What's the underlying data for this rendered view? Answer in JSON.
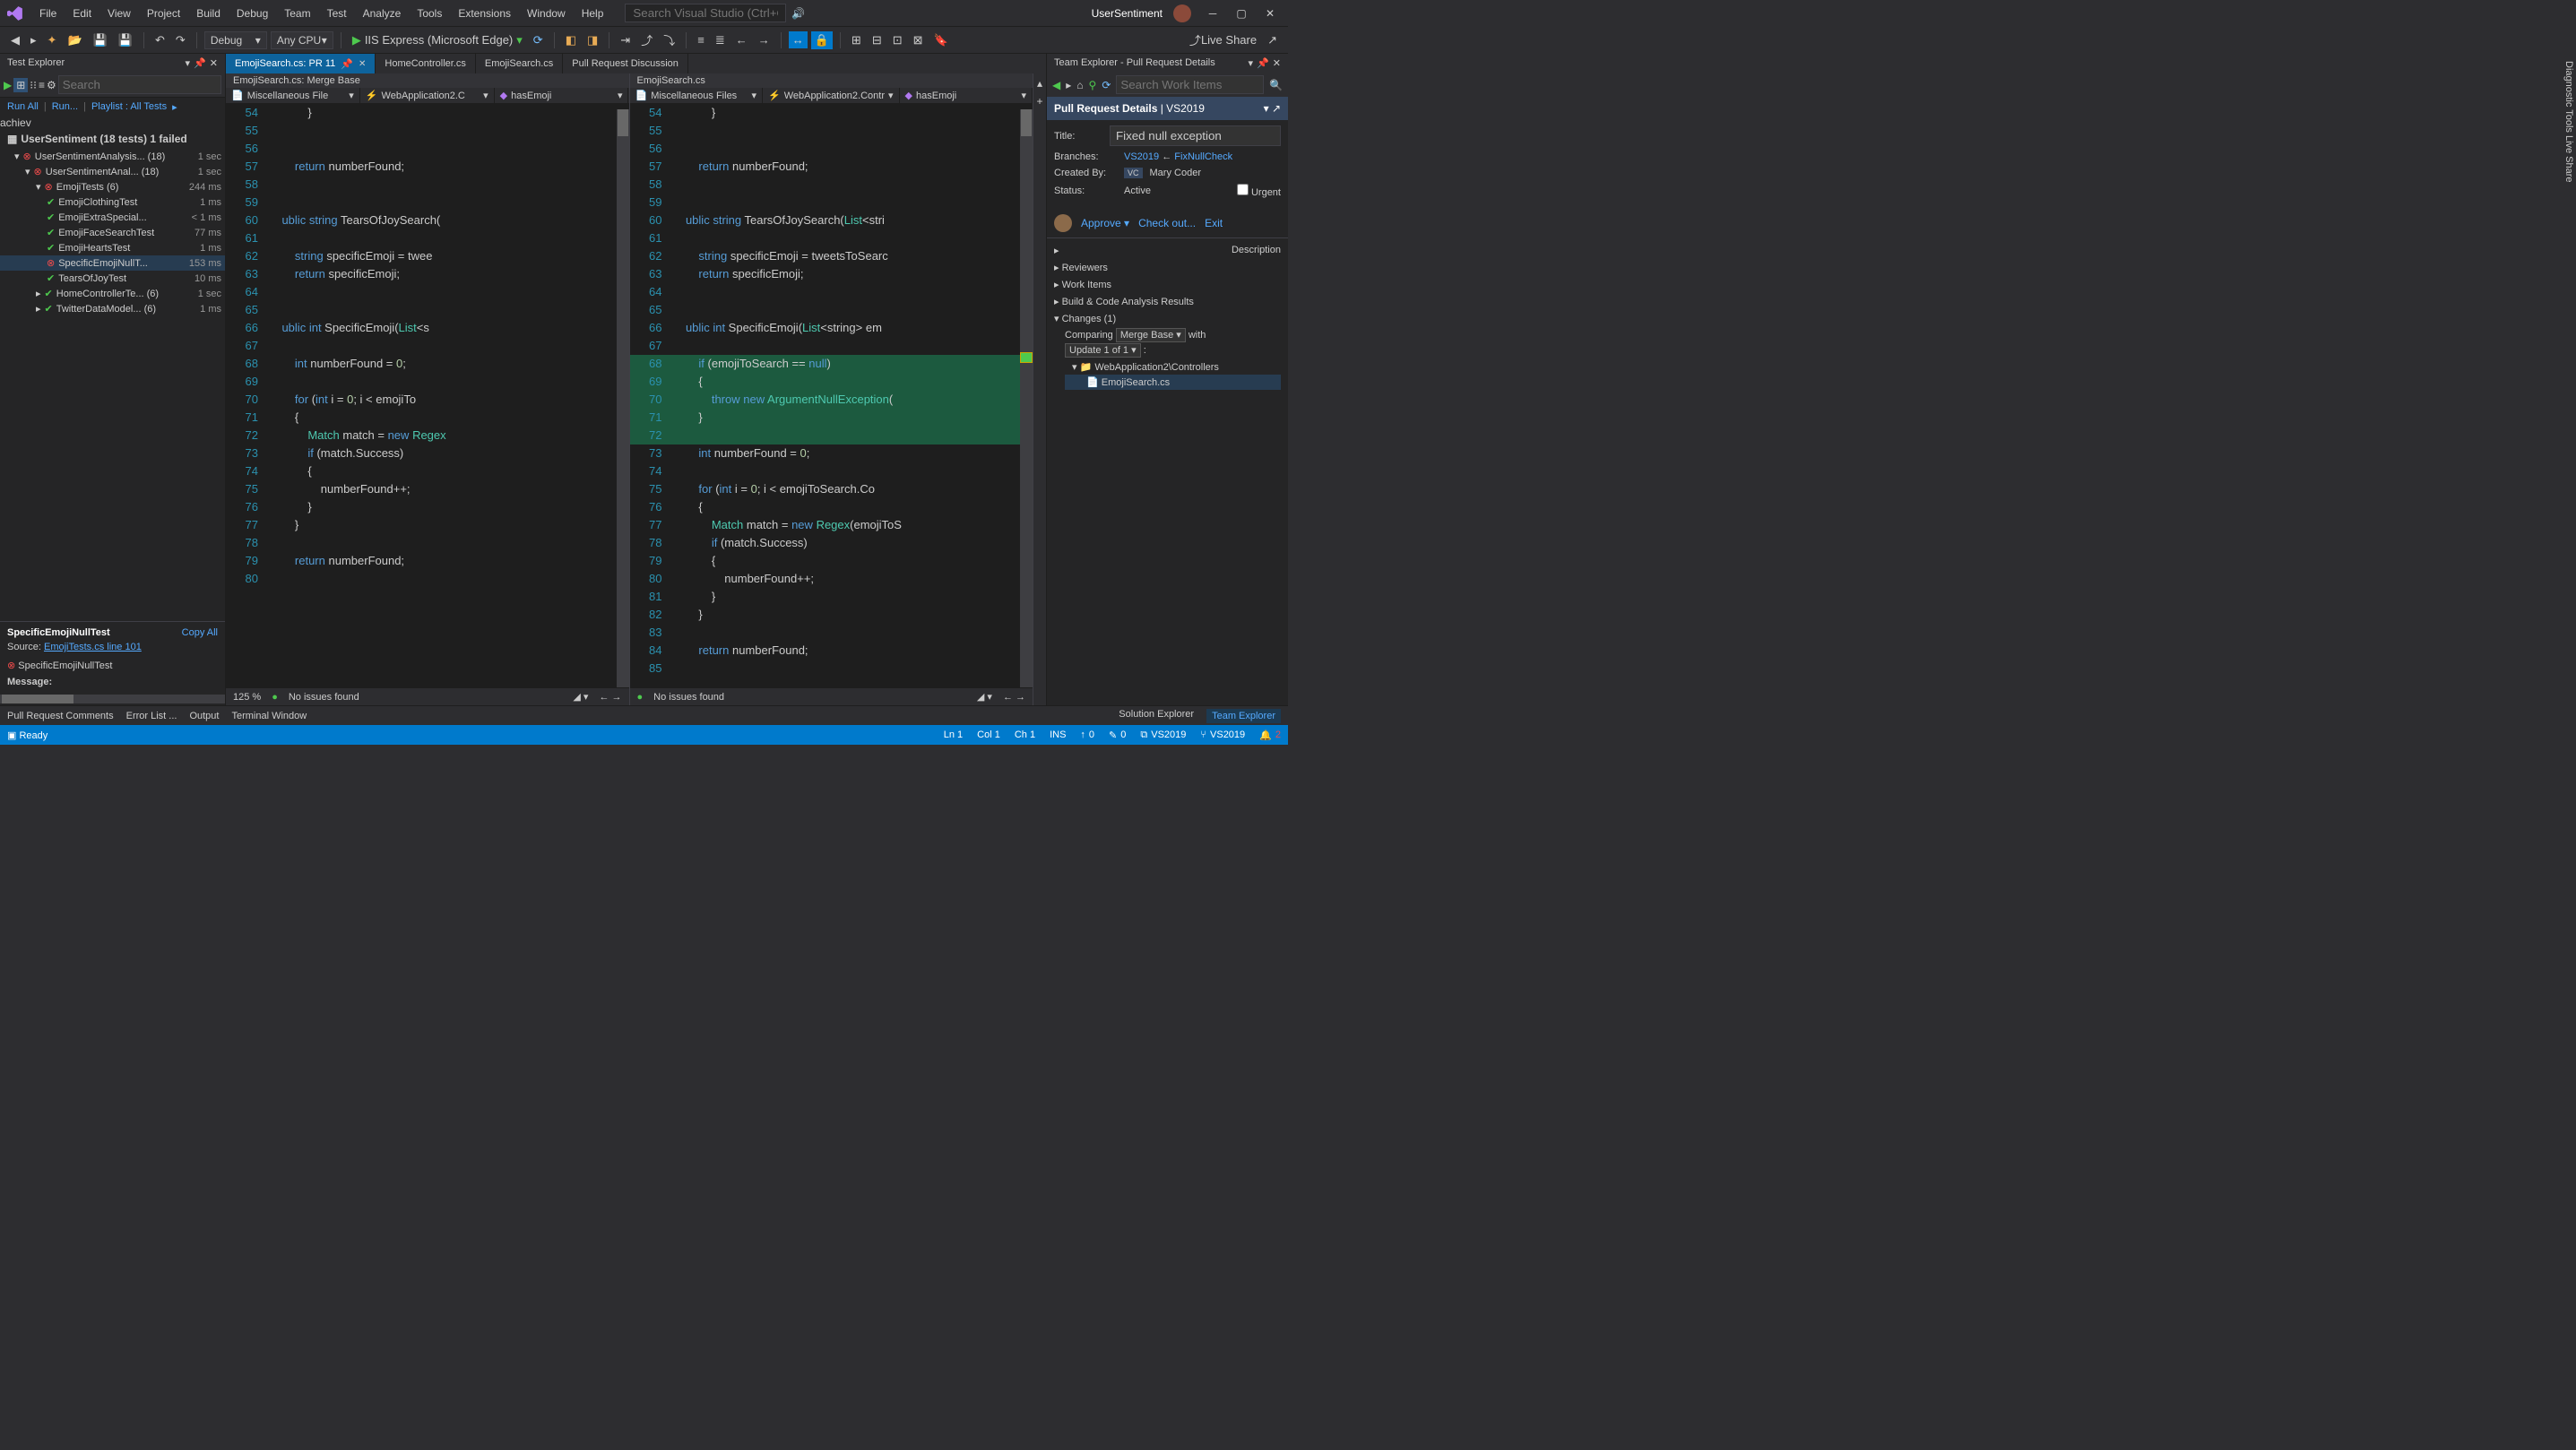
{
  "titlebar": {
    "menus": [
      "File",
      "Edit",
      "View",
      "Project",
      "Build",
      "Debug",
      "Team",
      "Test",
      "Analyze",
      "Tools",
      "Extensions",
      "Window",
      "Help"
    ],
    "search_placeholder": "Search Visual Studio (Ctrl+Q)",
    "solution": "UserSentiment"
  },
  "toolbar": {
    "config": "Debug",
    "platform": "Any CPU",
    "run_label": "IIS Express (Microsoft Edge)",
    "live_share": "Live Share"
  },
  "test_explorer": {
    "title": "Test Explorer",
    "search_placeholder": "Search",
    "links": {
      "run_all": "Run All",
      "run": "Run...",
      "playlist": "Playlist : All Tests"
    },
    "summary": "UserSentiment (18 tests) 1 failed",
    "tree": [
      {
        "indent": 1,
        "icon": "fail",
        "label": "UserSentimentAnalysis... (18)",
        "dur": "1 sec",
        "exp": "▾"
      },
      {
        "indent": 2,
        "icon": "fail",
        "label": "UserSentimentAnal... (18)",
        "dur": "1 sec",
        "exp": "▾"
      },
      {
        "indent": 3,
        "icon": "fail",
        "label": "EmojiTests (6)",
        "dur": "244 ms",
        "exp": "▾"
      },
      {
        "indent": 4,
        "icon": "pass",
        "label": "EmojiClothingTest",
        "dur": "1 ms"
      },
      {
        "indent": 4,
        "icon": "pass",
        "label": "EmojiExtraSpecial...",
        "dur": "< 1 ms"
      },
      {
        "indent": 4,
        "icon": "pass",
        "label": "EmojiFaceSearchTest",
        "dur": "77 ms"
      },
      {
        "indent": 4,
        "icon": "pass",
        "label": "EmojiHeartsTest",
        "dur": "1 ms"
      },
      {
        "indent": 4,
        "icon": "fail",
        "label": "SpecificEmojiNullT...",
        "dur": "153 ms",
        "sel": true
      },
      {
        "indent": 4,
        "icon": "pass",
        "label": "TearsOfJoyTest",
        "dur": "10 ms"
      },
      {
        "indent": 3,
        "icon": "pass",
        "label": "HomeControllerTe... (6)",
        "dur": "1 sec",
        "exp": "▸"
      },
      {
        "indent": 3,
        "icon": "pass",
        "label": "TwitterDataModel... (6)",
        "dur": "1 ms",
        "exp": "▸"
      }
    ],
    "detail": {
      "name": "SpecificEmojiNullTest",
      "copy": "Copy All",
      "source_lbl": "Source:",
      "source": "EmojiTests.cs line 101",
      "fail_name": "SpecificEmojiNullTest",
      "msg_lbl": "Message:"
    }
  },
  "tabs": [
    {
      "label": "EmojiSearch.cs: PR 11",
      "active": true,
      "pinned": true
    },
    {
      "label": "HomeController.cs"
    },
    {
      "label": "EmojiSearch.cs"
    },
    {
      "label": "Pull Request Discussion"
    }
  ],
  "left_pane": {
    "header": "EmojiSearch.cs: Merge Base",
    "nav": [
      "Miscellaneous File",
      "WebApplication2.C",
      "hasEmoji"
    ],
    "zoom": "125 %",
    "issues": "No issues found",
    "lines": [
      {
        "n": 54,
        "t": "            }"
      },
      {
        "n": 55,
        "t": ""
      },
      {
        "n": 56,
        "t": ""
      },
      {
        "n": 57,
        "t": "        return numberFound;",
        "kw": [
          "return"
        ]
      },
      {
        "n": 58,
        "t": ""
      },
      {
        "n": 59,
        "t": ""
      },
      {
        "n": 60,
        "t": "    ublic string TearsOfJoySearch(",
        "kw": [
          "ublic",
          "string"
        ]
      },
      {
        "n": 61,
        "t": ""
      },
      {
        "n": 62,
        "t": "        string specificEmoji = twee",
        "kw": [
          "string"
        ]
      },
      {
        "n": 63,
        "t": "        return specificEmoji;",
        "kw": [
          "return"
        ]
      },
      {
        "n": 64,
        "t": ""
      },
      {
        "n": 65,
        "t": ""
      },
      {
        "n": 66,
        "t": "    ublic int SpecificEmoji(List<s",
        "kw": [
          "ublic",
          "int"
        ]
      },
      {
        "n": 67,
        "t": ""
      },
      {
        "n": "",
        "t": "",
        "hatched": true
      },
      {
        "n": "",
        "t": "",
        "hatched": true
      },
      {
        "n": "",
        "t": "",
        "hatched": true
      },
      {
        "n": "",
        "t": "",
        "hatched": true
      },
      {
        "n": "",
        "t": "",
        "hatched": true
      },
      {
        "n": 68,
        "t": "        int numberFound = 0;",
        "kw": [
          "int"
        ]
      },
      {
        "n": 69,
        "t": ""
      },
      {
        "n": 70,
        "t": "        for (int i = 0; i < emojiTo",
        "kw": [
          "for",
          "int"
        ]
      },
      {
        "n": 71,
        "t": "        {"
      },
      {
        "n": 72,
        "t": "            Match match = new Regex",
        "kw": [
          "new"
        ]
      },
      {
        "n": 73,
        "t": "            if (match.Success)",
        "kw": [
          "if"
        ]
      },
      {
        "n": 74,
        "t": "            {"
      },
      {
        "n": 75,
        "t": "                numberFound++;"
      },
      {
        "n": 76,
        "t": "            }"
      },
      {
        "n": 77,
        "t": "        }"
      },
      {
        "n": 78,
        "t": ""
      },
      {
        "n": 79,
        "t": "        return numberFound;",
        "kw": [
          "return"
        ]
      },
      {
        "n": 80,
        "t": ""
      }
    ]
  },
  "right_pane": {
    "header": "EmojiSearch.cs",
    "nav": [
      "Miscellaneous Files",
      "WebApplication2.Contr",
      "hasEmoji"
    ],
    "issues": "No issues found",
    "lines": [
      {
        "n": 54,
        "t": "            }"
      },
      {
        "n": 55,
        "t": ""
      },
      {
        "n": 56,
        "t": ""
      },
      {
        "n": 57,
        "t": "        return numberFound;",
        "kw": [
          "return"
        ]
      },
      {
        "n": 58,
        "t": ""
      },
      {
        "n": 59,
        "t": ""
      },
      {
        "n": 60,
        "t": "    ublic string TearsOfJoySearch(List<stri",
        "kw": [
          "ublic",
          "string"
        ]
      },
      {
        "n": 61,
        "t": ""
      },
      {
        "n": 62,
        "t": "        string specificEmoji = tweetsToSearc",
        "kw": [
          "string"
        ]
      },
      {
        "n": 63,
        "t": "        return specificEmoji;",
        "kw": [
          "return"
        ]
      },
      {
        "n": 64,
        "t": ""
      },
      {
        "n": 65,
        "t": ""
      },
      {
        "n": 66,
        "t": "    ublic int SpecificEmoji(List<string> em",
        "kw": [
          "ublic",
          "int"
        ]
      },
      {
        "n": 67,
        "t": ""
      },
      {
        "n": 68,
        "t": "        if (emojiToSearch == null)",
        "kw": [
          "if",
          "null"
        ],
        "added": true
      },
      {
        "n": 69,
        "t": "        {",
        "added": true
      },
      {
        "n": 70,
        "t": "            throw new ArgumentNullException(",
        "kw": [
          "throw",
          "new"
        ],
        "added": true
      },
      {
        "n": 71,
        "t": "        }",
        "added": true
      },
      {
        "n": 72,
        "t": "",
        "added": true
      },
      {
        "n": 73,
        "t": "        int numberFound = 0;",
        "kw": [
          "int"
        ]
      },
      {
        "n": 74,
        "t": ""
      },
      {
        "n": 75,
        "t": "        for (int i = 0; i < emojiToSearch.Co",
        "kw": [
          "for",
          "int"
        ]
      },
      {
        "n": 76,
        "t": "        {"
      },
      {
        "n": 77,
        "t": "            Match match = new Regex(emojiToS",
        "kw": [
          "new"
        ]
      },
      {
        "n": 78,
        "t": "            if (match.Success)",
        "kw": [
          "if"
        ]
      },
      {
        "n": 79,
        "t": "            {"
      },
      {
        "n": 80,
        "t": "                numberFound++;"
      },
      {
        "n": 81,
        "t": "            }"
      },
      {
        "n": 82,
        "t": "        }"
      },
      {
        "n": 83,
        "t": ""
      },
      {
        "n": 84,
        "t": "        return numberFound;",
        "kw": [
          "return"
        ]
      },
      {
        "n": 85,
        "t": ""
      }
    ]
  },
  "team_explorer": {
    "title": "Team Explorer - Pull Request Details",
    "search_placeholder": "Search Work Items",
    "header": "Pull Request Details",
    "header_sub": "VS2019",
    "title_lbl": "Title:",
    "title_val": "Fixed null exception",
    "branches_lbl": "Branches:",
    "branch_target": "VS2019",
    "branch_source": "FixNullCheck",
    "created_lbl": "Created By:",
    "created_by": "Mary Coder",
    "status_lbl": "Status:",
    "status_val": "Active",
    "urgent_lbl": "Urgent",
    "approve": "Approve",
    "checkout": "Check out...",
    "exit": "Exit",
    "sections": [
      "Description",
      "Reviewers",
      "Work Items",
      "Build & Code Analysis Results"
    ],
    "changes_lbl": "Changes (1)",
    "comparing": "Comparing",
    "compare_base": "Merge Base",
    "compare_with": "with",
    "update": "Update 1 of 1",
    "folder": "WebApplication2\\Controllers",
    "file": "EmojiSearch.cs"
  },
  "bottom": {
    "left_tabs": [
      "Pull Request Comments",
      "Error List ...",
      "Output",
      "Terminal Window"
    ],
    "right_tabs": [
      "Solution Explorer",
      "Team Explorer"
    ]
  },
  "status": {
    "ready": "Ready",
    "line": "Ln 1",
    "col": "Col 1",
    "ch": "Ch 1",
    "ins": "INS",
    "up": "0",
    "pen": "0",
    "repo": "VS2019",
    "branch": "VS2019",
    "notif": "2"
  },
  "side_tab": "Diagnostic Tools  Live Share"
}
